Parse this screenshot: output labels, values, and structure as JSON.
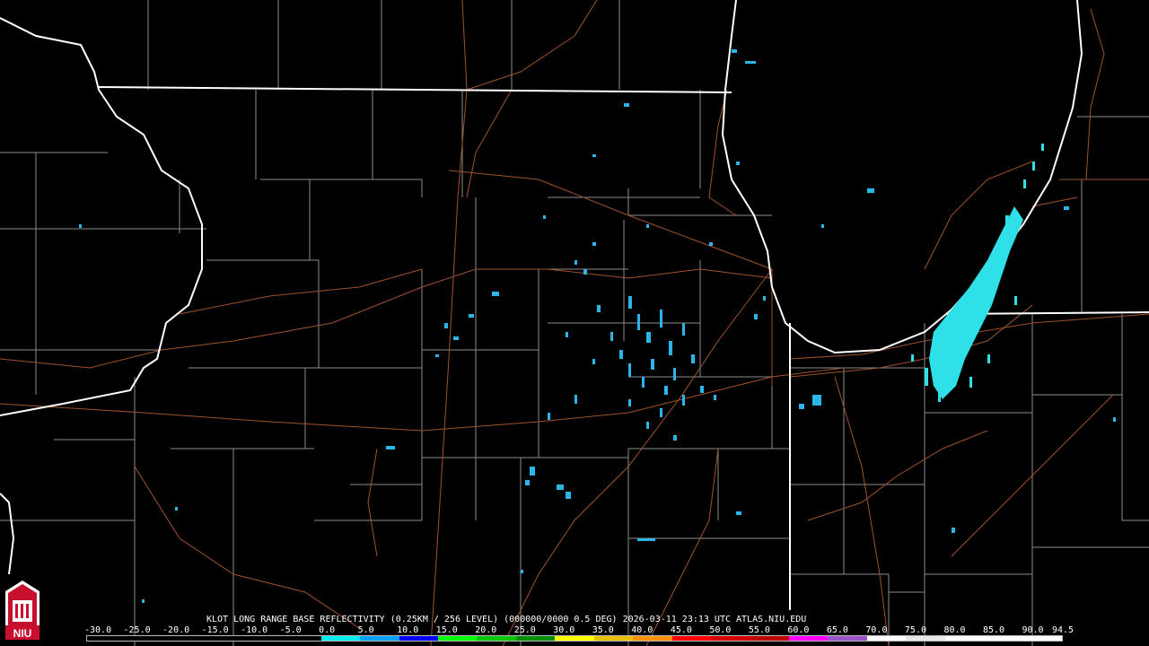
{
  "product": {
    "caption": "KLOT LONG RANGE BASE REFLECTIVITY (0.25KM / 256 LEVEL) (000000/0000 0.5 DEG) 2026-03-11 23:13 UTC  ATLAS.NIU.EDU"
  },
  "logo": {
    "text": "NIU",
    "colors": {
      "red": "#c8102e",
      "white": "#ffffff"
    }
  },
  "color_scale": {
    "labels": [
      "-30.0",
      "-25.0",
      "-20.0",
      "-15.0",
      "-10.0",
      "-5.0",
      "0.0",
      "5.0",
      "10.0",
      "15.0",
      "20.0",
      "25.0",
      "30.0",
      "35.0",
      "40.0",
      "45.0",
      "50.0",
      "55.0",
      "60.0",
      "65.0",
      "70.0",
      "75.0",
      "80.0",
      "85.0",
      "90.0",
      "94.5"
    ],
    "colors": [
      "#000000",
      "#000000",
      "#000000",
      "#000000",
      "#000000",
      "#000000",
      "#00ecec",
      "#01a0f6",
      "#0000f6",
      "#00ff00",
      "#00c800",
      "#009000",
      "#ffff00",
      "#e7c000",
      "#ff9000",
      "#ff0000",
      "#d60000",
      "#c00000",
      "#ff00ff",
      "#9955c9",
      "#ffffff",
      "#e8e8e8",
      "#ffffff",
      "#ffffff",
      "#ffffff"
    ]
  },
  "map_colors": {
    "background": "#000000",
    "state_border": "#ffffff",
    "county_border": "#8c8c8c",
    "highway": "#a0522d",
    "echo_light": "#2bb5e8",
    "echo_cyan": "#2fe0e8"
  }
}
